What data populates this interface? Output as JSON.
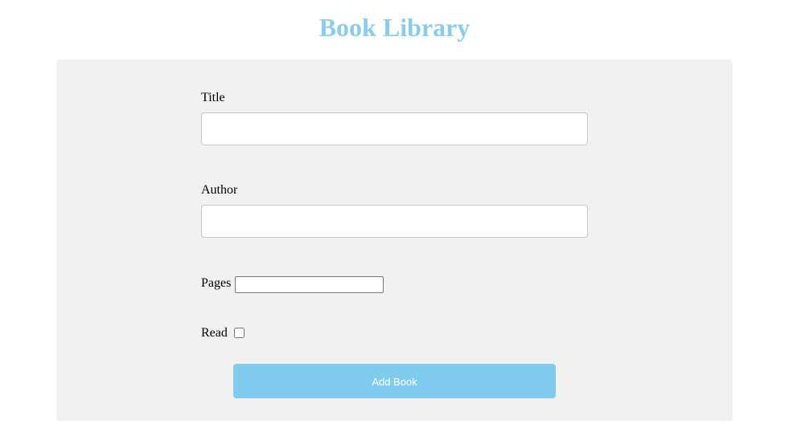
{
  "header": {
    "title": "Book Library"
  },
  "form": {
    "title_label": "Title",
    "title_value": "",
    "author_label": "Author",
    "author_value": "",
    "pages_label": "Pages",
    "pages_value": "",
    "read_label": "Read",
    "read_checked": false,
    "submit_label": "Add Book"
  },
  "colors": {
    "accent": "#87ceeb",
    "panel_background": "#f1f1f1",
    "button_text": "#ffffff"
  }
}
